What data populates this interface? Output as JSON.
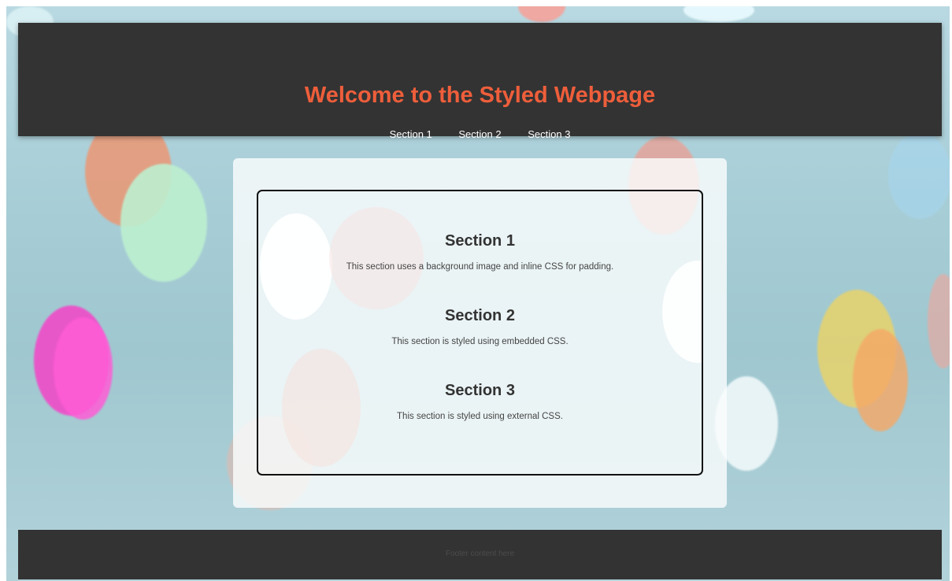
{
  "header": {
    "title": "Welcome to the Styled Webpage",
    "nav": [
      "Section 1",
      "Section 2",
      "Section 3"
    ]
  },
  "main": {
    "sections": [
      {
        "heading": "Section 1",
        "text": "This section uses a background image and inline CSS for padding."
      },
      {
        "heading": "Section 2",
        "text": "This section is styled using embedded CSS."
      },
      {
        "heading": "Section 3",
        "text": "This section is styled using external CSS."
      }
    ]
  },
  "footer": {
    "text": "Footer content here"
  },
  "colors": {
    "header_bg": "#333333",
    "title": "#ee5e3b",
    "nav_text": "#ffffff",
    "footer_bg": "#333333"
  }
}
